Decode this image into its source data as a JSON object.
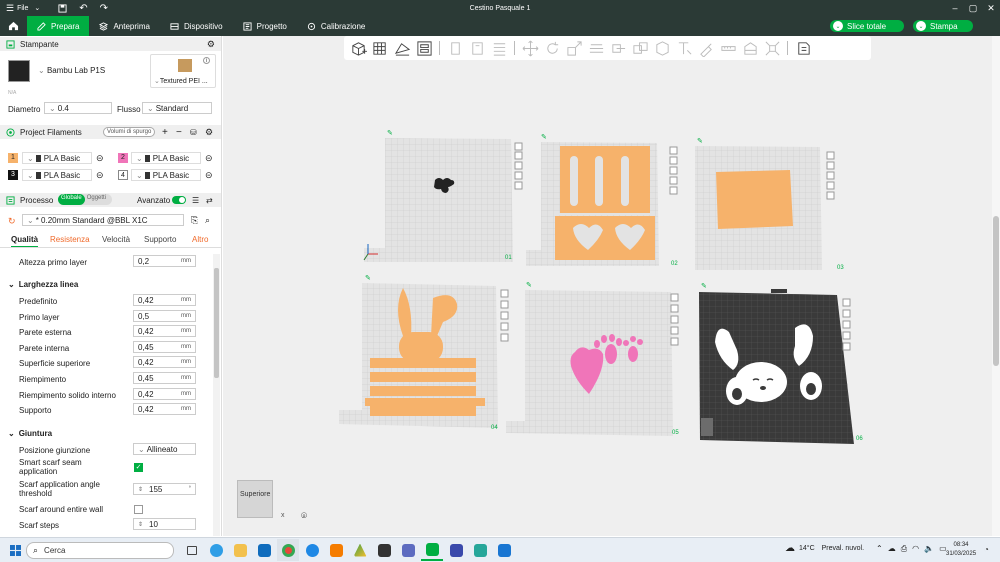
{
  "window": {
    "title": "Cestino Pasquale 1",
    "file_menu": "File"
  },
  "nav": {
    "tabs": [
      {
        "label": "Prepara",
        "active": true
      },
      {
        "label": "Anteprima"
      },
      {
        "label": "Dispositivo"
      },
      {
        "label": "Progetto"
      },
      {
        "label": "Calibrazione"
      }
    ],
    "slice_label": "Slice totale",
    "print_label": "Stampa"
  },
  "colors": {
    "accent": "#00ae42",
    "titlebar": "#2b3a36",
    "plate_part": "#f6b26b",
    "pink": "#f075b9"
  },
  "printer": {
    "section_title": "Stampante",
    "name": "Bambu Lab P1S",
    "status": "N/A",
    "plate_type": "Textured PEI ...",
    "diametro_label": "Diametro",
    "diametro_value": "0.4",
    "flusso_label": "Flusso",
    "flusso_value": "Standard"
  },
  "filaments": {
    "section_title": "Project Filaments",
    "purge_button": "Volumi di spurgo",
    "items": [
      {
        "num": "1",
        "name": "PLA Basic",
        "color": "#f6b26b"
      },
      {
        "num": "2",
        "name": "PLA Basic",
        "color": "#f075b9"
      },
      {
        "num": "3",
        "name": "PLA Basic",
        "color": "#111111"
      },
      {
        "num": "4",
        "name": "PLA Basic",
        "color": "#ffffff"
      }
    ]
  },
  "process": {
    "section_title": "Processo",
    "toggle_global": "Globale",
    "toggle_objects": "Oggetti",
    "advanced_label": "Avanzato",
    "preset": "* 0.20mm Standard @BBL X1C",
    "tabs": [
      "Qualità",
      "Resistenza",
      "Velocità",
      "Supporto",
      "Altro"
    ]
  },
  "settings": {
    "first_layer_height": {
      "label": "Altezza primo layer",
      "value": "0,2",
      "unit": "mm"
    },
    "line_width_group": "Larghezza linea",
    "line_widths": [
      {
        "label": "Predefinito",
        "value": "0,42",
        "unit": "mm"
      },
      {
        "label": "Primo layer",
        "value": "0,5",
        "unit": "mm"
      },
      {
        "label": "Parete esterna",
        "value": "0,42",
        "unit": "mm"
      },
      {
        "label": "Parete interna",
        "value": "0,45",
        "unit": "mm"
      },
      {
        "label": "Superficie superiore",
        "value": "0,42",
        "unit": "mm"
      },
      {
        "label": "Riempimento",
        "value": "0,45",
        "unit": "mm"
      },
      {
        "label": "Riempimento solido interno",
        "value": "0,42",
        "unit": "mm"
      },
      {
        "label": "Supporto",
        "value": "0,42",
        "unit": "mm"
      }
    ],
    "seam_group": "Giuntura",
    "seam_position_label": "Posizione giunzione",
    "seam_position_value": "Allineato",
    "smart_scarf_label": "Smart scarf seam application",
    "smart_scarf_checked": true,
    "scarf_angle_label": "Scarf application angle threshold",
    "scarf_angle_value": "155",
    "scarf_angle_unit": "°",
    "scarf_entire_wall_label": "Scarf around entire wall",
    "scarf_entire_wall_checked": false,
    "scarf_steps_label": "Scarf steps",
    "scarf_steps_value": "10"
  },
  "plates": [
    {
      "number": "01"
    },
    {
      "number": "02"
    },
    {
      "number": "03"
    },
    {
      "number": "04"
    },
    {
      "number": "05"
    },
    {
      "number": "06"
    }
  ],
  "view_cube_label": "Superiore",
  "taskbar": {
    "search_placeholder": "Cerca",
    "weather_temp": "14°C",
    "weather_desc": "Preval. nuvol.",
    "time": "08:34",
    "date": "31/03/2025"
  }
}
